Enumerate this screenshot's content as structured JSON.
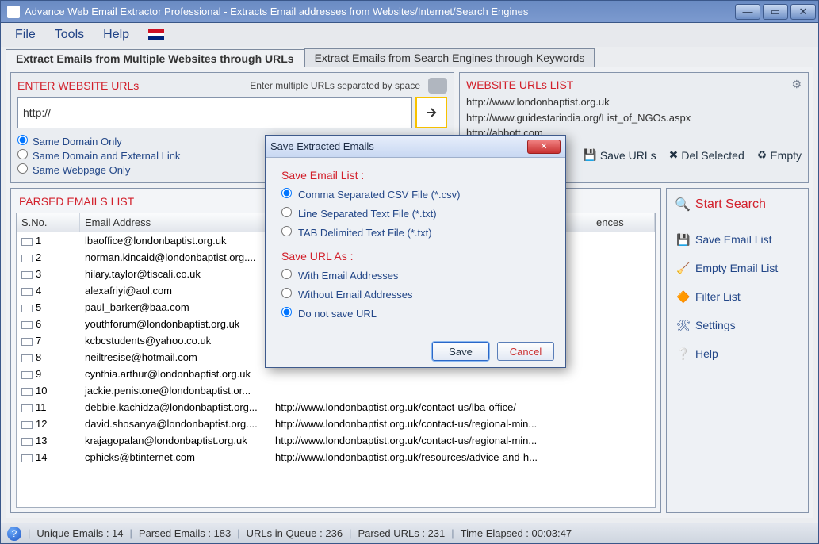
{
  "window": {
    "title": "Advance Web Email Extractor Professional - Extracts Email addresses from Websites/Internet/Search Engines"
  },
  "menu": {
    "file": "File",
    "tools": "Tools",
    "help": "Help"
  },
  "tabs": {
    "tab1": "Extract Emails from Multiple Websites through URLs",
    "tab2": "Extract Emails from Search Engines through Keywords"
  },
  "enter": {
    "title": "ENTER WEBSITE URLs",
    "hint": "Enter multiple URLs separated by space",
    "value": "http://",
    "opt1": "Same Domain Only",
    "opt2": "Same Domain and External Link",
    "opt3": "Same Webpage Only"
  },
  "urllist": {
    "title": "WEBSITE URLs LIST",
    "items": [
      "http://www.londonbaptist.org.uk",
      "http://www.guidestarindia.org/List_of_NGOs.aspx",
      "http://abbott.com"
    ],
    "save": "Save URLs",
    "del": "Del Selected",
    "empty": "Empty"
  },
  "parsed": {
    "title": "PARSED EMAILS LIST",
    "cols": {
      "sno": "S.No.",
      "email": "Email Address",
      "url": "",
      "occ": "ences"
    },
    "rows": [
      {
        "n": "1",
        "email": "lbaoffice@londonbaptist.org.uk",
        "url": ""
      },
      {
        "n": "2",
        "email": "norman.kincaid@londonbaptist.org....",
        "url": ""
      },
      {
        "n": "3",
        "email": "hilary.taylor@tiscali.co.uk",
        "url": ""
      },
      {
        "n": "4",
        "email": "alexafriyi@aol.com",
        "url": ""
      },
      {
        "n": "5",
        "email": "paul_barker@baa.com",
        "url": ""
      },
      {
        "n": "6",
        "email": "youthforum@londonbaptist.org.uk",
        "url": ""
      },
      {
        "n": "7",
        "email": "kcbcstudents@yahoo.co.uk",
        "url": ""
      },
      {
        "n": "8",
        "email": "neiltresise@hotmail.com",
        "url": ""
      },
      {
        "n": "9",
        "email": "cynthia.arthur@londonbaptist.org.uk",
        "url": ""
      },
      {
        "n": "10",
        "email": "jackie.penistone@londonbaptist.or...",
        "url": ""
      },
      {
        "n": "11",
        "email": "debbie.kachidza@londonbaptist.org...",
        "url": "http://www.londonbaptist.org.uk/contact-us/lba-office/"
      },
      {
        "n": "12",
        "email": "david.shosanya@londonbaptist.org....",
        "url": "http://www.londonbaptist.org.uk/contact-us/regional-min..."
      },
      {
        "n": "13",
        "email": "krajagopalan@londonbaptist.org.uk",
        "url": "http://www.londonbaptist.org.uk/contact-us/regional-min..."
      },
      {
        "n": "14",
        "email": "cphicks@btinternet.com",
        "url": "http://www.londonbaptist.org.uk/resources/advice-and-h..."
      }
    ]
  },
  "sidebar": {
    "start": "Start Search",
    "save": "Save Email List",
    "empty": "Empty Email List",
    "filter": "Filter List",
    "settings": "Settings",
    "help": "Help"
  },
  "status": {
    "unique": "Unique Emails :  14",
    "parsed": "Parsed Emails :  183",
    "queue": "URLs in Queue :  236",
    "purls": "Parsed URLs :  231",
    "time": "Time Elapsed :  00:03:47"
  },
  "modal": {
    "title": "Save Extracted Emails",
    "section1": "Save Email List :",
    "o1": "Comma Separated CSV File (*.csv)",
    "o2": "Line Separated Text File (*.txt)",
    "o3": "TAB Delimited Text File (*.txt)",
    "section2": "Save URL As  :",
    "u1": "With Email Addresses",
    "u2": "Without Email Addresses",
    "u3": "Do not save URL",
    "save": "Save",
    "cancel": "Cancel"
  }
}
